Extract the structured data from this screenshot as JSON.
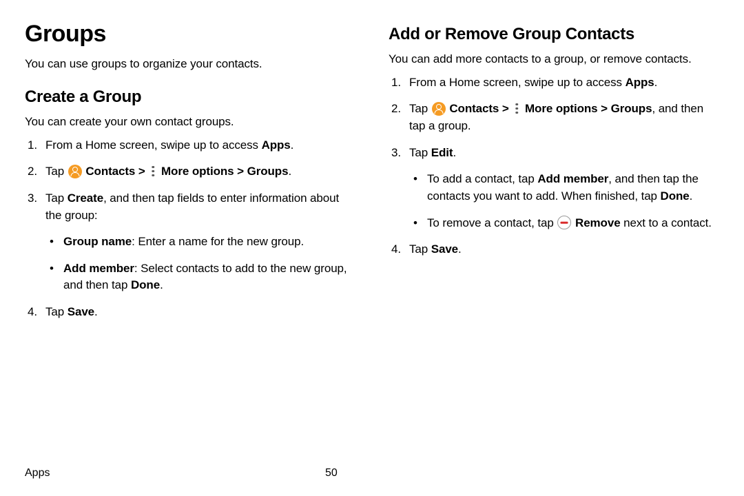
{
  "left": {
    "h1": "Groups",
    "intro": "You can use groups to organize your contacts.",
    "h2": "Create a Group",
    "sub": "You can create your own contact groups.",
    "step1_a": "From a Home screen, swipe up to access ",
    "step1_b": "Apps",
    "step1_c": ".",
    "step2_a": "Tap ",
    "step2_b": " Contacts ",
    "step2_c": " More options ",
    "step2_d": "Groups",
    "step2_e": ".",
    "step3_a": "Tap ",
    "step3_b": "Create",
    "step3_c": ", and then tap fields to enter information about the group:",
    "bullet1_a": "Group name",
    "bullet1_b": ": Enter a name for the new group.",
    "bullet2_a": "Add member",
    "bullet2_b": ": Select contacts to add to the new group, and then tap ",
    "bullet2_c": "Done",
    "bullet2_d": ".",
    "step4_a": "Tap ",
    "step4_b": "Save",
    "step4_c": "."
  },
  "right": {
    "h2": "Add or Remove Group Contacts",
    "intro": "You can add more contacts to a group, or remove contacts.",
    "step1_a": "From a Home screen, swipe up to access ",
    "step1_b": "Apps",
    "step1_c": ".",
    "step2_a": "Tap ",
    "step2_b": " Contacts ",
    "step2_c": " More options ",
    "step2_d": "Groups",
    "step2_e": ", and then tap a group.",
    "step3_a": "Tap ",
    "step3_b": "Edit",
    "step3_c": ".",
    "bullet1_a": "To add a contact, tap ",
    "bullet1_b": "Add member",
    "bullet1_c": ", and then tap the contacts you want to add. When finished, tap ",
    "bullet1_d": "Done",
    "bullet1_e": ".",
    "bullet2_a": "To remove a contact, tap ",
    "bullet2_b": " Remove",
    "bullet2_c": " next to a contact.",
    "step4_a": "Tap ",
    "step4_b": "Save",
    "step4_c": "."
  },
  "chevron": ">",
  "footer": {
    "section": "Apps",
    "page": "50"
  }
}
